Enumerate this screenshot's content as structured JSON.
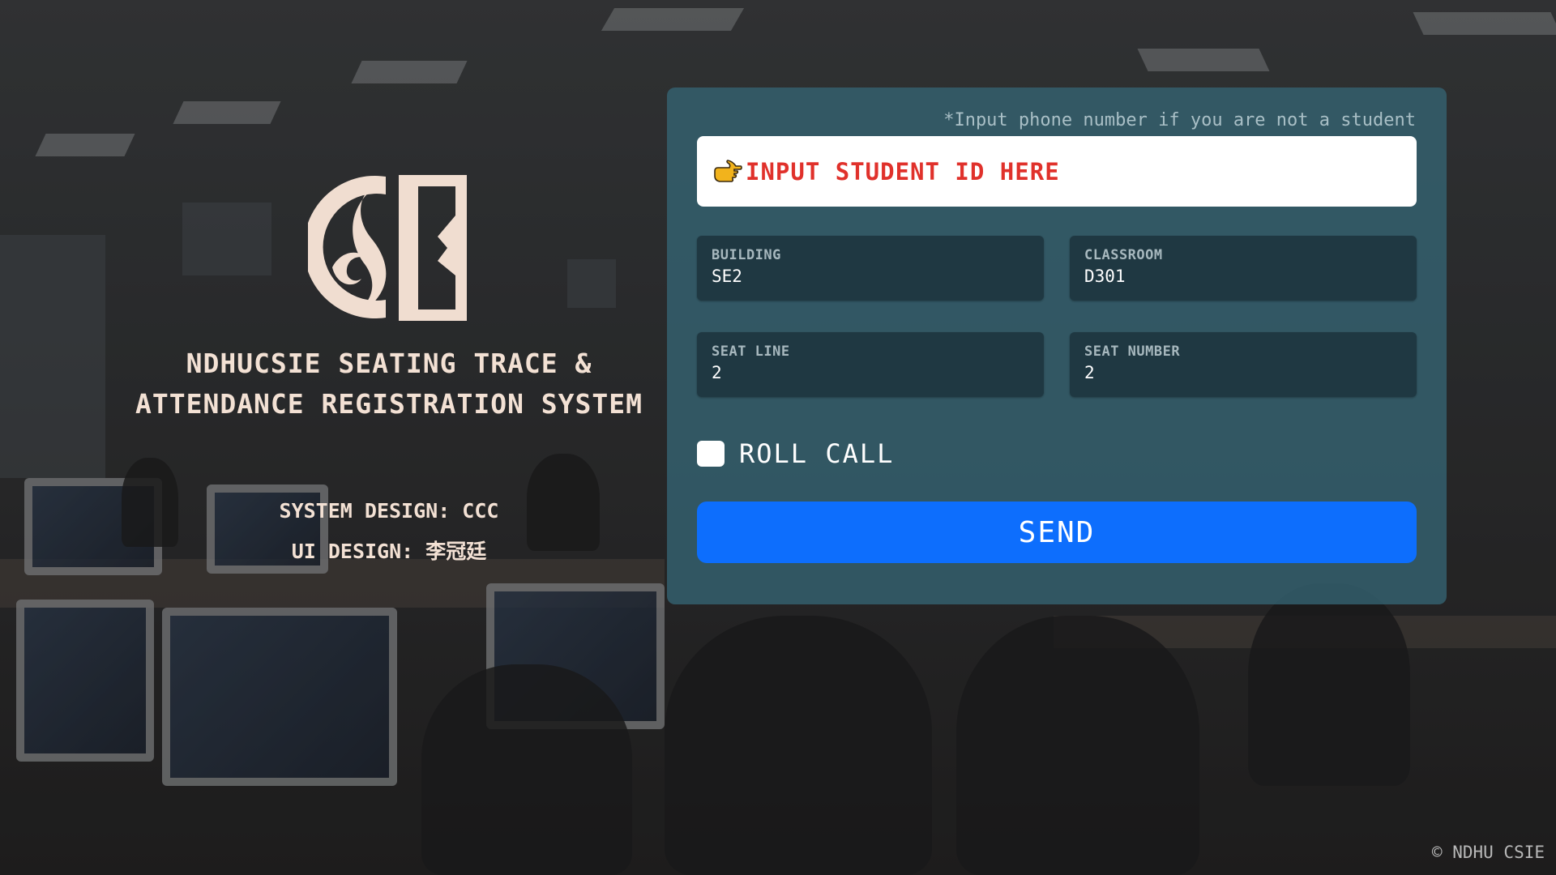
{
  "brand": {
    "logo_icon": "csie-logo-icon",
    "title_line1": "NDHUCSIE SEATING TRACE &",
    "title_line2": "ATTENDANCE REGISTRATION SYSTEM",
    "system_design": "SYSTEM DESIGN: CCC",
    "ui_design": "UI DESIGN: 李冠廷"
  },
  "form": {
    "hint": "*Input phone number if you are not a student",
    "student_id": {
      "icon": "pointing-hand-icon",
      "placeholder": "INPUT STUDENT ID HERE",
      "value": ""
    },
    "building": {
      "label": "BUILDING",
      "value": "SE2"
    },
    "classroom": {
      "label": "CLASSROOM",
      "value": "D301"
    },
    "seat_line": {
      "label": "SEAT LINE",
      "value": "2"
    },
    "seat_number": {
      "label": "SEAT NUMBER",
      "value": "2"
    },
    "roll_call": {
      "label": "ROLL CALL",
      "checked": false
    },
    "send_label": "SEND"
  },
  "footer": {
    "copyright": "© NDHU CSIE"
  },
  "colors": {
    "accent_button": "#0d6efd",
    "placeholder_red": "#e0312b",
    "card_bg": "#346270",
    "brand_text": "#f3e1d4"
  }
}
